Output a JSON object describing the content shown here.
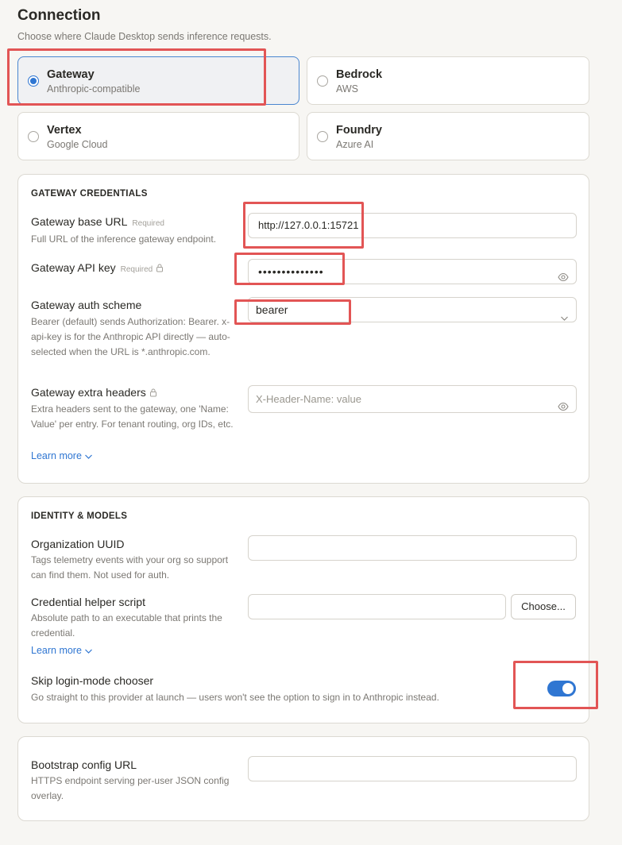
{
  "header": {
    "title": "Connection",
    "subtitle": "Choose where Claude Desktop sends inference requests."
  },
  "providers": [
    {
      "name": "Gateway",
      "desc": "Anthropic-compatible",
      "selected": true
    },
    {
      "name": "Bedrock",
      "desc": "AWS",
      "selected": false
    },
    {
      "name": "Vertex",
      "desc": "Google Cloud",
      "selected": false
    },
    {
      "name": "Foundry",
      "desc": "Azure AI",
      "selected": false
    }
  ],
  "gateway": {
    "section_title": "GATEWAY CREDENTIALS",
    "base_url": {
      "label": "Gateway base URL",
      "required": "Required",
      "help": "Full URL of the inference gateway endpoint.",
      "value": "http://127.0.0.1:15721"
    },
    "api_key": {
      "label": "Gateway API key",
      "required": "Required",
      "value": "••••••••••••••"
    },
    "auth_scheme": {
      "label": "Gateway auth scheme",
      "help": "Bearer (default) sends Authorization: Bearer. x-api-key is for the Anthropic API directly — auto-selected when the URL is *.anthropic.com.",
      "value": "bearer"
    },
    "extra_headers": {
      "label": "Gateway extra headers",
      "help": "Extra headers sent to the gateway, one 'Name: Value' per entry. For tenant routing, org IDs, etc.",
      "placeholder": "X-Header-Name: value"
    },
    "learn_more": "Learn more"
  },
  "identity": {
    "section_title": "IDENTITY & MODELS",
    "org_uuid": {
      "label": "Organization UUID",
      "help": "Tags telemetry events with your org so support can find them. Not used for auth.",
      "value": ""
    },
    "helper_script": {
      "label": "Credential helper script",
      "help": "Absolute path to an executable that prints the credential.",
      "value": "",
      "button": "Choose..."
    },
    "learn_more": "Learn more",
    "skip_login": {
      "label": "Skip login-mode chooser",
      "help": "Go straight to this provider at launch — users won't see the option to sign in to Anthropic instead.",
      "enabled": true
    }
  },
  "bootstrap": {
    "label": "Bootstrap config URL",
    "help": "HTTPS endpoint serving per-user JSON config overlay.",
    "value": ""
  },
  "colors": {
    "accent": "#2f76d2",
    "highlight": "#e25555"
  }
}
